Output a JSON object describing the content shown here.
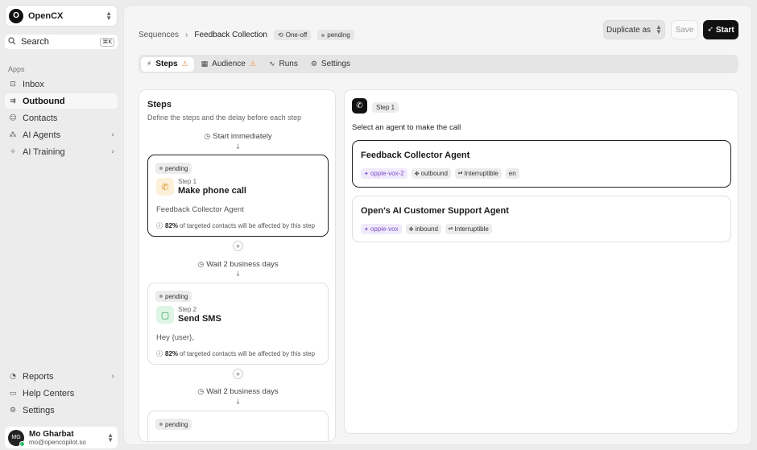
{
  "workspace": {
    "logo_letter": "O",
    "name": "OpenCX"
  },
  "search": {
    "label": "Search",
    "shortcut": "⌘K"
  },
  "sidebar": {
    "section_label": "Apps",
    "items": [
      {
        "label": "Inbox",
        "icon": "inbox-icon"
      },
      {
        "label": "Outbound",
        "icon": "outbound-icon",
        "active": true
      },
      {
        "label": "Contacts",
        "icon": "contacts-icon"
      },
      {
        "label": "AI Agents",
        "icon": "ai-agents-icon",
        "has_chevron": true
      },
      {
        "label": "AI Training",
        "icon": "ai-training-icon",
        "has_chevron": true
      }
    ],
    "bottom_items": [
      {
        "label": "Reports",
        "icon": "reports-icon",
        "has_chevron": true
      },
      {
        "label": "Help Centers",
        "icon": "help-centers-icon"
      },
      {
        "label": "Settings",
        "icon": "settings-icon"
      }
    ],
    "user": {
      "initials": "MG",
      "name": "Mo Gharbat",
      "email": "mo@opencopilot.so"
    }
  },
  "header": {
    "breadcrumb_root": "Sequences",
    "breadcrumb_current": "Feedback Collection",
    "type_badge": "One-off",
    "status_badge": "pending",
    "duplicate_label": "Duplicate as",
    "save_label": "Save",
    "start_label": "Start"
  },
  "tabs": [
    {
      "label": "Steps",
      "active": true,
      "warning": true
    },
    {
      "label": "Audience",
      "warning": true
    },
    {
      "label": "Runs"
    },
    {
      "label": "Settings"
    }
  ],
  "steps_panel": {
    "title": "Steps",
    "subtitle": "Define the steps and the delay before each step",
    "start_timing": "Start immediately",
    "steps": [
      {
        "status": "pending",
        "step_label": "Step 1",
        "title": "Make phone call",
        "body": "Feedback Collector Agent",
        "affected_pct": "82%",
        "affected_text": "of targeted contacts will be affected by this step",
        "delay_after": "Wait 2 business days"
      },
      {
        "status": "pending",
        "step_label": "Step 2",
        "title": "Send SMS",
        "body": "Hey {user},",
        "affected_pct": "82%",
        "affected_text": "of targeted contacts will be affected by this step",
        "delay_after": "Wait 2 business days"
      },
      {
        "status": "pending"
      }
    ]
  },
  "detail_panel": {
    "step_label": "Step 1",
    "prompt": "Select an agent to make the call",
    "agents": [
      {
        "name": "Feedback Collector Agent",
        "voice": "oppie-vox-2",
        "direction": "outbound",
        "mode": "Interruptible",
        "language": "en",
        "selected": true
      },
      {
        "name": "Open's AI Customer Support Agent",
        "voice": "oppie-vox",
        "direction": "inbound",
        "mode": "Interruptible"
      }
    ]
  },
  "colors": {
    "accent": "#111111",
    "warning": "#e8873a",
    "voice_tag": "#7b4fc4",
    "call_icon_bg": "#fdf0d8",
    "sms_icon_bg": "#dff5e6"
  }
}
